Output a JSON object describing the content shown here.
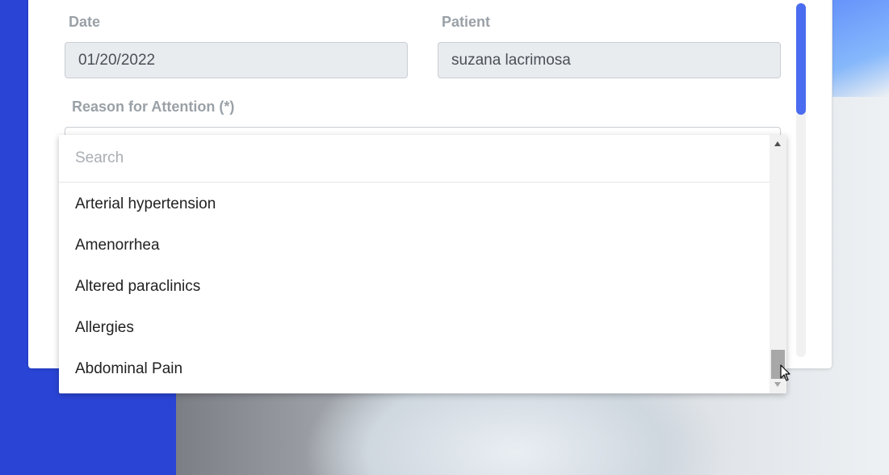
{
  "form": {
    "date_label": "Date",
    "date_value": "01/20/2022",
    "patient_label": "Patient",
    "patient_value": "suzana lacrimosa",
    "reason_label": "Reason for Attention (*)"
  },
  "dropdown": {
    "search_placeholder": "Search",
    "options": [
      "Arterial hypertension",
      "Amenorrhea",
      "Altered paraclinics",
      "Allergies",
      "Abdominal Pain"
    ]
  },
  "colors": {
    "background_blue": "#2a45d6",
    "scroll_accent": "#4a6cf0"
  },
  "icons": {
    "cursor": "mouse-pointer-icon"
  }
}
